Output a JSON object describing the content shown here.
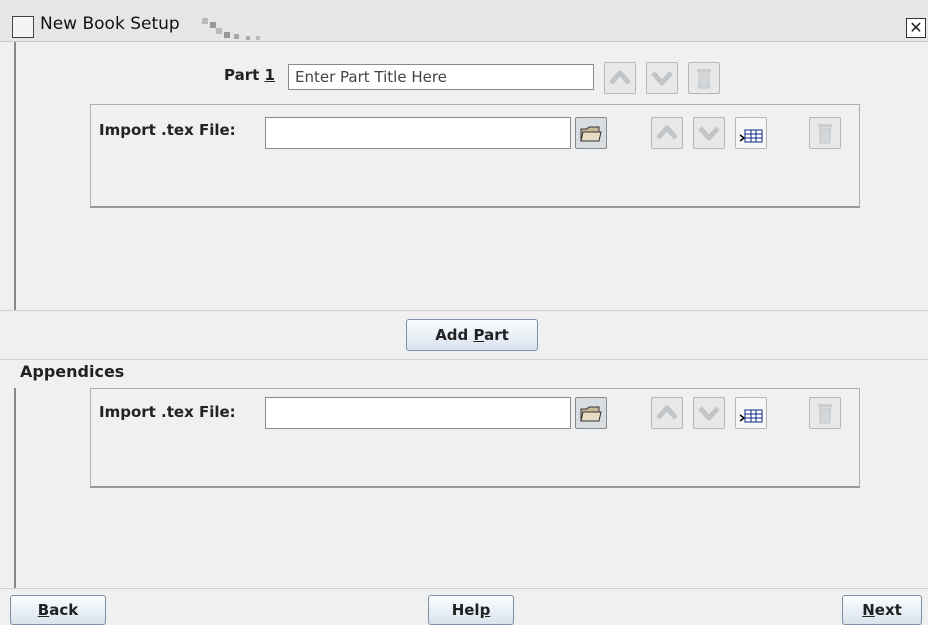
{
  "window": {
    "title": "New Book Setup",
    "close_glyph": "✕"
  },
  "part": {
    "label_prefix": "Part ",
    "number": "1",
    "title_placeholder": "Enter Part Title Here",
    "import_label": "Import .tex File:",
    "import_value": ""
  },
  "add_part": {
    "label_before": "Add ",
    "mnemonic": "P",
    "label_after": "art"
  },
  "appendices": {
    "header": "Appendices",
    "import_label": "Import .tex File:",
    "import_value": ""
  },
  "footer": {
    "back_mnemonic": "B",
    "back_rest": "ack",
    "help_before": "Hel",
    "help_mnemonic": "p",
    "next_mnemonic": "N",
    "next_rest": "ext"
  },
  "icons": {
    "folder": "folder-open-icon",
    "up": "arrow-up-icon",
    "down": "arrow-down-icon",
    "trash": "trash-icon",
    "table": "insert-table-icon"
  },
  "colors": {
    "background": "#f0f0f0",
    "button_border": "#7f8fa6",
    "disabled_icon": "#9aa0a6"
  }
}
